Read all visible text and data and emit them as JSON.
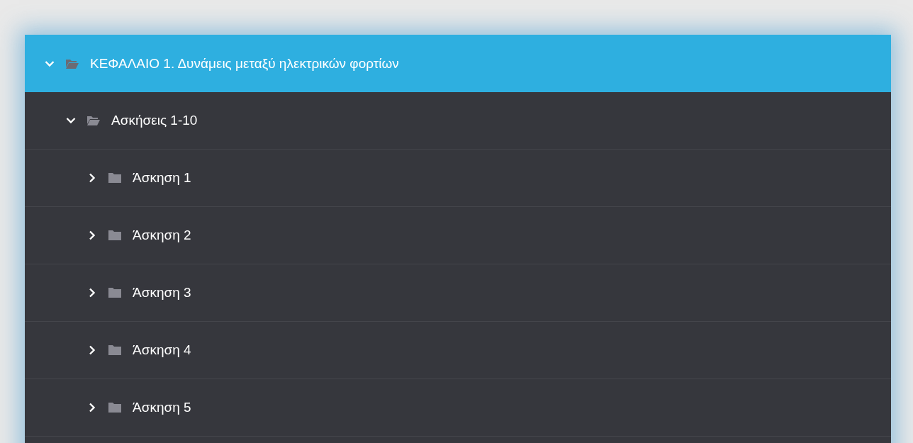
{
  "tree": [
    {
      "label": "ΚΕΦΑΛΑΙΟ 1. Δυνάμεις μεταξύ ηλεκτρικών φορτίων",
      "expanded": true,
      "selected": true,
      "children": [
        {
          "label": "Ασκήσεις 1-10",
          "expanded": true,
          "selected": false,
          "children": [
            {
              "label": "Άσκηση 1",
              "expanded": false,
              "selected": false
            },
            {
              "label": "Άσκηση 2",
              "expanded": false,
              "selected": false
            },
            {
              "label": "Άσκηση 3",
              "expanded": false,
              "selected": false
            },
            {
              "label": "Άσκηση 4",
              "expanded": false,
              "selected": false
            },
            {
              "label": "Άσκηση 5",
              "expanded": false,
              "selected": false
            }
          ]
        }
      ]
    }
  ]
}
